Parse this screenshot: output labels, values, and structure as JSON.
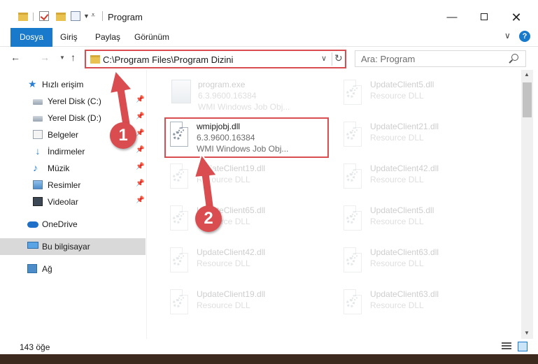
{
  "window": {
    "title": "Program",
    "controls": {
      "minimize": "—",
      "maximize": "",
      "close": "✕"
    }
  },
  "ribbon": {
    "tabs": [
      {
        "label": "Dosya",
        "active": true
      },
      {
        "label": "Giriş"
      },
      {
        "label": "Paylaş"
      },
      {
        "label": "Görünüm"
      }
    ],
    "help_label": "?",
    "accent_color": "#1979ca"
  },
  "navigation": {
    "address_path": "C:\\Program Files\\Program Dizini",
    "search_placeholder": "Ara: Program"
  },
  "sidebar": {
    "items": [
      {
        "label": "Hızlı erişim",
        "icon": "star-icon"
      },
      {
        "label": "Yerel Disk (C:)",
        "icon": "disk-icon",
        "pinned": true
      },
      {
        "label": "Yerel Disk (D:)",
        "icon": "disk-icon",
        "pinned": true
      },
      {
        "label": "Belgeler",
        "icon": "documents-icon",
        "pinned": true
      },
      {
        "label": "İndirmeler",
        "icon": "download-icon",
        "pinned": true
      },
      {
        "label": "Müzik",
        "icon": "music-icon",
        "pinned": true
      },
      {
        "label": "Resimler",
        "icon": "pictures-icon",
        "pinned": true
      },
      {
        "label": "Videolar",
        "icon": "videos-icon",
        "pinned": true
      },
      {
        "label": "OneDrive",
        "icon": "cloud-icon"
      },
      {
        "label": "Bu bilgisayar",
        "icon": "computer-icon",
        "selected": true
      },
      {
        "label": "Ağ",
        "icon": "network-icon"
      }
    ]
  },
  "files": {
    "left_column": [
      {
        "name": "program.exe",
        "line2": "6.3.9600.16384",
        "line3": "WMI Windows Job Obj...",
        "faded": true
      },
      {
        "name": "wmipjobj.dll",
        "line2": "6.3.9600.16384",
        "line3": "WMI Windows Job Obj...",
        "faded": false,
        "highlighted": true
      },
      {
        "name": "UpdateClient19.dll",
        "line2": "Resource DLL",
        "faded": true
      },
      {
        "name": "UpdateClient65.dll",
        "line2": "Resource DLL",
        "faded": true
      },
      {
        "name": "UpdateClient42.dll",
        "line2": "Resource DLL",
        "faded": true
      },
      {
        "name": "UpdateClient19.dll",
        "line2": "Resource DLL",
        "faded": true
      }
    ],
    "right_column": [
      {
        "name": "UpdateClient5.dll",
        "line2": "Resource DLL",
        "faded": true
      },
      {
        "name": "UpdateClient21.dll",
        "line2": "Resource DLL",
        "faded": true
      },
      {
        "name": "UpdateClient42.dll",
        "line2": "Resource DLL",
        "faded": true
      },
      {
        "name": "UpdateClient5.dll",
        "line2": "Resource DLL",
        "faded": true
      },
      {
        "name": "UpdateClient63.dll",
        "line2": "Resource DLL",
        "faded": true
      },
      {
        "name": "UpdateClient63.dll",
        "line2": "Resource DLL",
        "faded": true
      }
    ]
  },
  "status": {
    "item_count": "143 öğe"
  },
  "annotations": {
    "step1": "1",
    "step2": "2",
    "highlight_color": "#d94c4f"
  }
}
